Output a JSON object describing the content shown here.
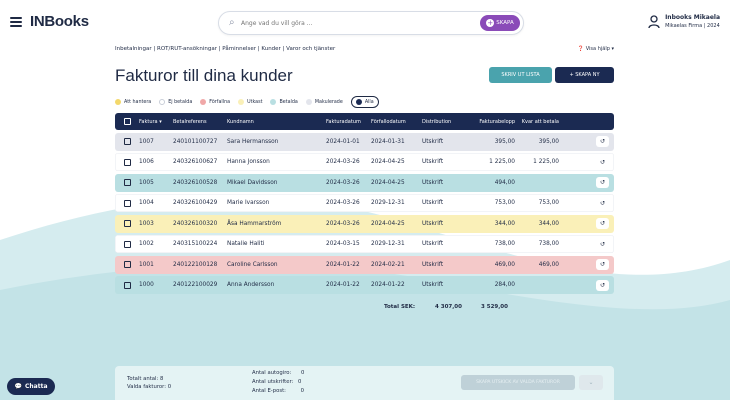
{
  "app": {
    "logo": "INBooks"
  },
  "search": {
    "placeholder": "Ange vad du vill göra ...",
    "create_label": "SKAPA"
  },
  "user": {
    "name": "Inbooks Mikaela",
    "company": "Mikaelas Firma | 2024"
  },
  "breadcrumbs": "Inbetalningar | ROT/RUT-ansökningar | Påminnelser | Kunder | Varor och tjänster",
  "help_label": "Visa hjälp",
  "page_title": "Fakturor till dina kunder",
  "buttons": {
    "print_list": "SKRIV UT LISTA",
    "create_new": "SKAPA NY"
  },
  "legend": [
    {
      "label": "Att hantera",
      "color": "#f3d86b"
    },
    {
      "label": "Ej betalda",
      "color": "#ffffff"
    },
    {
      "label": "Förfallna",
      "color": "#f0a8a8"
    },
    {
      "label": "Utkast",
      "color": "#faf0b8"
    },
    {
      "label": "Betalda",
      "color": "#b9dfe2"
    },
    {
      "label": "Makulerade",
      "color": "#e3e5ec"
    },
    {
      "label": "Alla",
      "color": "#1b2a52"
    }
  ],
  "table": {
    "columns": [
      "Faktura",
      "Betalreferens",
      "Kundnamn",
      "Fakturadatum",
      "Förfallodatum",
      "Distribution",
      "Fakturabelopp",
      "Kvar att betala"
    ],
    "rows": [
      {
        "nr": "1007",
        "ref": "240101100727",
        "name": "Sara Hermansson",
        "date": "2024-01-01",
        "due": "2024-01-31",
        "dist": "Utskrift",
        "amount": "395,00",
        "left": "395,00",
        "bg": "#e3e5ec"
      },
      {
        "nr": "1006",
        "ref": "240326100627",
        "name": "Hanna Jonsson",
        "date": "2024-03-26",
        "due": "2024-04-25",
        "dist": "Utskrift",
        "amount": "1 225,00",
        "left": "1 225,00",
        "bg": "#ffffff"
      },
      {
        "nr": "1005",
        "ref": "240326100528",
        "name": "Mikael Davidsson",
        "date": "2024-03-26",
        "due": "2024-04-25",
        "dist": "Utskrift",
        "amount": "494,00",
        "left": "",
        "bg": "#b9dfe2"
      },
      {
        "nr": "1004",
        "ref": "240326100429",
        "name": "Marie Ivarsson",
        "date": "2024-03-26",
        "due": "2029-12-31",
        "dist": "Utskrift",
        "amount": "753,00",
        "left": "753,00",
        "bg": "#ffffff"
      },
      {
        "nr": "1003",
        "ref": "240326100320",
        "name": "Åsa Hammarström",
        "date": "2024-03-26",
        "due": "2024-04-25",
        "dist": "Utskrift",
        "amount": "344,00",
        "left": "344,00",
        "bg": "#faf0b8"
      },
      {
        "nr": "1002",
        "ref": "240315100224",
        "name": "Natalie Haliti",
        "date": "2024-03-15",
        "due": "2029-12-31",
        "dist": "Utskrift",
        "amount": "738,00",
        "left": "738,00",
        "bg": "#ffffff"
      },
      {
        "nr": "1001",
        "ref": "240122100128",
        "name": "Caroline Carlsson",
        "date": "2024-01-22",
        "due": "2024-02-21",
        "dist": "Utskrift",
        "amount": "469,00",
        "left": "469,00",
        "bg": "#f4c9c9"
      },
      {
        "nr": "1000",
        "ref": "240122100029",
        "name": "Anna Andersson",
        "date": "2024-01-22",
        "due": "2024-01-22",
        "dist": "Utskrift",
        "amount": "284,00",
        "left": "",
        "bg": "#b9dfe2"
      }
    ]
  },
  "totals": {
    "label": "Total SEK:",
    "amount": "4 307,00",
    "left": "3 529,00"
  },
  "footer": {
    "total_count": "Totalt antal: 8",
    "selected": "Valda fakturor: 0",
    "autogiro": "Antal autogiro:",
    "autogiro_val": "0",
    "prints": "Antal utskrifter:",
    "prints_val": "0",
    "emails": "Antal E-post:",
    "emails_val": "0",
    "action_label": "SKAPA UTSKICK AV VALDA FAKTUROR",
    "more_label": "⌄"
  },
  "chat_label": "Chatta"
}
